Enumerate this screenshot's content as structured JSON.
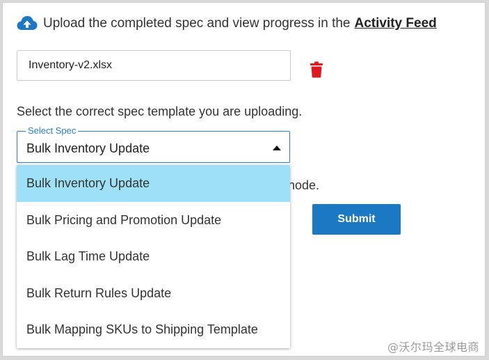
{
  "upload": {
    "text": "Upload the completed spec and view progress in the",
    "link_label": "Activity Feed",
    "icon": "cloud-upload-icon"
  },
  "file": {
    "name": "Inventory-v2.xlsx",
    "delete_icon": "trash-icon"
  },
  "instruction": "Select the correct spec template you are uploading.",
  "partially_hidden_text": "node.",
  "select": {
    "legend": "Select Spec",
    "value": "Bulk Inventory Update",
    "options": [
      "Bulk Inventory Update",
      "Bulk Pricing and Promotion Update",
      "Bulk Lag Time Update",
      "Bulk Return Rules Update",
      "Bulk Mapping SKUs to Shipping Template"
    ],
    "selected_index": 0
  },
  "submit_label": "Submit",
  "watermark": "@沃尔玛全球电商",
  "colors": {
    "accent": "#2c7ecb",
    "button": "#1b78c2",
    "selected_option": "#9ee0f6",
    "trash": "#e0191f"
  }
}
